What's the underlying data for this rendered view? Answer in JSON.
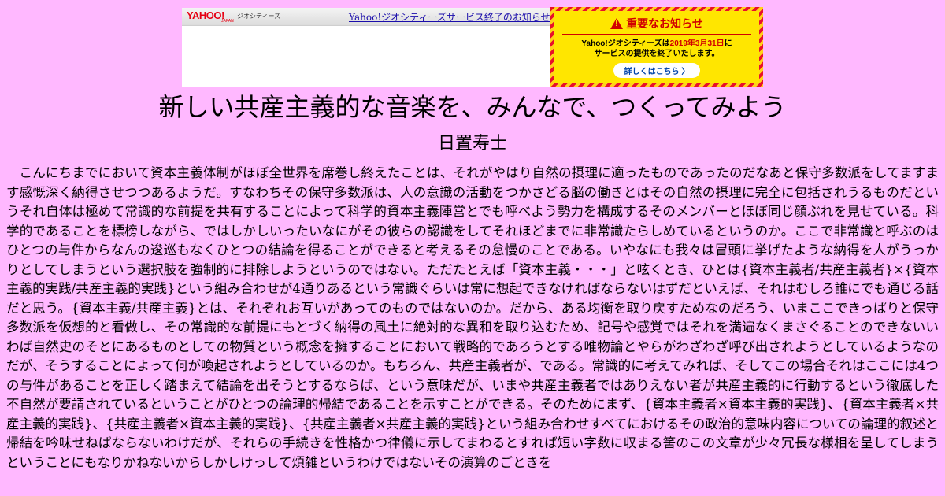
{
  "banner": {
    "logo": "YAHOO!",
    "logo_sub": "JAPAN",
    "service_name": "ジオシティーズ",
    "link_text": "Yahoo!ジオシティーズサービス終了のお知らせ"
  },
  "notice": {
    "title": "重要なお知らせ",
    "line1_pre": "Yahoo!ジオシティーズは",
    "line1_date": "2019年3月31日",
    "line1_post": "に",
    "line2": "サービスの提供を終了いたします。",
    "button": "詳しくはこちら 〉",
    "colors": {
      "red": "#e8102a",
      "yellow": "#ffe600"
    }
  },
  "page": {
    "title": "新しい共産主義的な音楽を、みんなで、つくってみよう",
    "author": "日置寿士",
    "body": "こんにちまでにおいて資本主義体制がほぼ全世界を席巻し終えたことは、それがやはり自然の摂理に適ったものであったのだなあと保守多数派をしてますます感慨深く納得させつつあるようだ。すなわちその保守多数派は、人の意識の活動をつかさどる脳の働きとはその自然の摂理に完全に包括されうるものだというそれ自体は極めて常識的な前提を共有することによって科学的資本主義陣営とでも呼べよう勢力を構成するそのメンバーとほぼ同じ顔ぶれを見せている。科学的であることを標榜しながら、ではしかしいったいなにがその彼らの認識をしてそれほどまでに非常識たらしめているというのか。ここで非常識と呼ぶのはひとつの与件からなんの逡巡もなくひとつの結論を得ることができると考えるその怠慢のことである。いやなにも我々は冒頭に挙げたような納得を人がうっかりとしてしまうという選択肢を強制的に排除しようというのではない。ただたとえば「資本主義・・・」と呟くとき、ひとは{資本主義者/共産主義者}×{資本主義的実践/共産主義的実践}という組み合わせが4通りあるという常識ぐらいは常に想起できなければならないはずだといえば、それはむしろ誰にでも通じる話だと思う。{資本主義/共産主義}とは、それぞれお互いがあってのものではないのか。だから、ある均衡を取り戻すためなのだろう、いまここできっぱりと保守多数派を仮想的と看做し、その常識的な前提にもとづく納得の風土に絶対的な異和を取り込むため、記号や感覚ではそれを満遍なくまさぐることのできないいわば自然史のそとにあるものとしての物質という概念を擁することにおいて戦略的であろうとする唯物論とやらがわざわざ呼び出されようとしているようなのだが、そうすることによって何が喚起されようとしているのか。もちろん、共産主義者が、である。常識的に考えてみれば、そしてこの場合それはここには4つの与件があることを正しく踏まえて結論を出そうとするならば、という意味だが、いまや共産主義者ではありえない者が共産主義的に行動するという徹底した不自然が要請されているということがひとつの論理的帰結であることを示すことができる。そのためにまず、{資本主義者×資本主義的実践}、{資本主義者×共産主義的実践}、{共産主義者×資本主義的実践}、{共産主義者×共産主義的実践}という組み合わせすべてにおけるその政治的意味内容についての論理的叙述と帰結を吟味せねばならないわけだが、それらの手続きを性格かつ律儀に示してまわるとすれば短い字数に収まる筈のこの文章が少々冗長な様相を呈してしまうということにもなりかねないからしかしけっして煩雑というわけではないその演算のごときを"
  }
}
